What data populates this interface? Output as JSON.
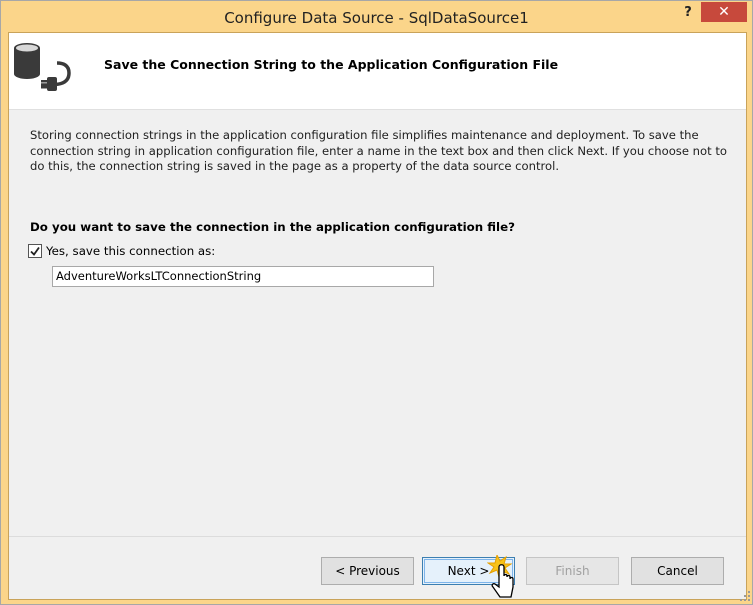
{
  "window": {
    "title": "Configure Data Source - SqlDataSource1",
    "help": "?",
    "close": "✕"
  },
  "header": {
    "icon": "database-plug-icon",
    "title": "Save the Connection String to the Application Configuration File"
  },
  "body": {
    "description": "Storing connection strings in the application configuration file simplifies maintenance and deployment. To save the connection string in application configuration file, enter a name in the text box and then click Next. If you choose not to do this, the connection string is saved in the page as a property of the data source control.",
    "question": "Do you want to save the connection in the application configuration file?",
    "save_checkbox_label": "Yes, save this connection as:",
    "save_checkbox_checked": true,
    "connection_name_value": "AdventureWorksLTConnectionString"
  },
  "footer": {
    "previous_label": "< Previous",
    "next_label": "Next >",
    "finish_label": "Finish",
    "cancel_label": "Cancel"
  },
  "colors": {
    "title_bar": "#fbd58a",
    "close_button": "#c7493c",
    "client_bg": "#f0f0f0"
  }
}
